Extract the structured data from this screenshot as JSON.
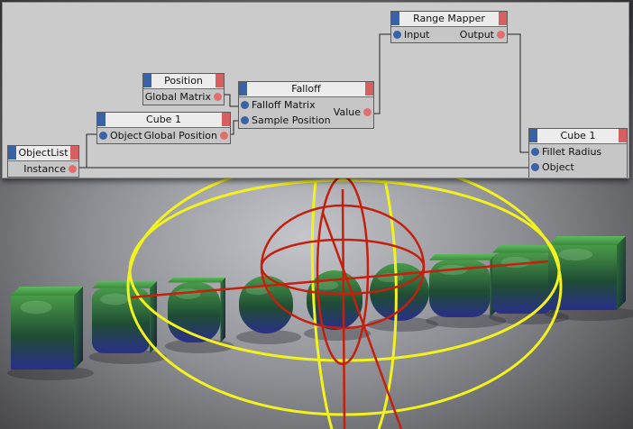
{
  "node_editor": {
    "nodes": {
      "range_mapper": {
        "title": "Range Mapper",
        "input": "Input",
        "output": "Output"
      },
      "position": {
        "title": "Position",
        "output": "Global Matrix"
      },
      "falloff": {
        "title": "Falloff",
        "input1": "Falloff Matrix",
        "input2": "Sample Position",
        "output": "Value"
      },
      "cube1_source": {
        "title": "Cube 1",
        "input": "Object",
        "output": "Global Position"
      },
      "object_list": {
        "title": "ObjectList",
        "output": "Instance"
      },
      "cube1_target": {
        "title": "Cube 1",
        "input1": "Fillet Radius",
        "input2": "Object"
      }
    }
  },
  "viewport": {
    "cube_count": 9,
    "fillet_level": [
      0.0,
      0.35,
      0.75,
      1.0,
      1.0,
      1.0,
      0.55,
      0.25,
      0.0
    ],
    "colors": {
      "cube_top": "#3f8f3f",
      "cube_bottom": "#2a2f8a",
      "falloff_gizmo": "#f2f21e",
      "axis_gizmo": "#c3200f",
      "floor": "#7c7d82"
    }
  }
}
